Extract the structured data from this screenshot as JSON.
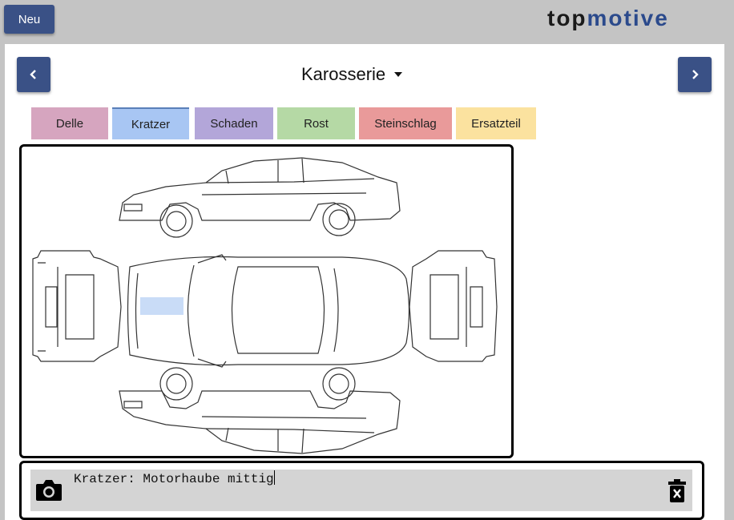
{
  "header": {
    "new_button_label": "Neu",
    "logo_text": "topmotive"
  },
  "panel": {
    "section_title": "Karosserie",
    "prev_icon": "chevron-left-icon",
    "next_icon": "chevron-right-icon",
    "dropdown_icon": "caret-down-icon"
  },
  "tabs": [
    {
      "label": "Delle",
      "color": "#d6a5bf"
    },
    {
      "label": "Kratzer",
      "color": "#a8c6f3",
      "active": true
    },
    {
      "label": "Schaden",
      "color": "#b3a6d9"
    },
    {
      "label": "Rost",
      "color": "#b5d9a5"
    },
    {
      "label": "Steinschlag",
      "color": "#e99a9a"
    },
    {
      "label": "Ersatzteil",
      "color": "#fbe29f"
    }
  ],
  "damage_marker": {
    "type": "Kratzer",
    "color": "#c9dcf7"
  },
  "note": {
    "text": "Kratzer: Motorhaube mittig",
    "camera_icon": "camera-icon",
    "delete_icon": "trash-icon"
  },
  "colors": {
    "accent": "#3a5186",
    "background": "#c4c4c4"
  }
}
